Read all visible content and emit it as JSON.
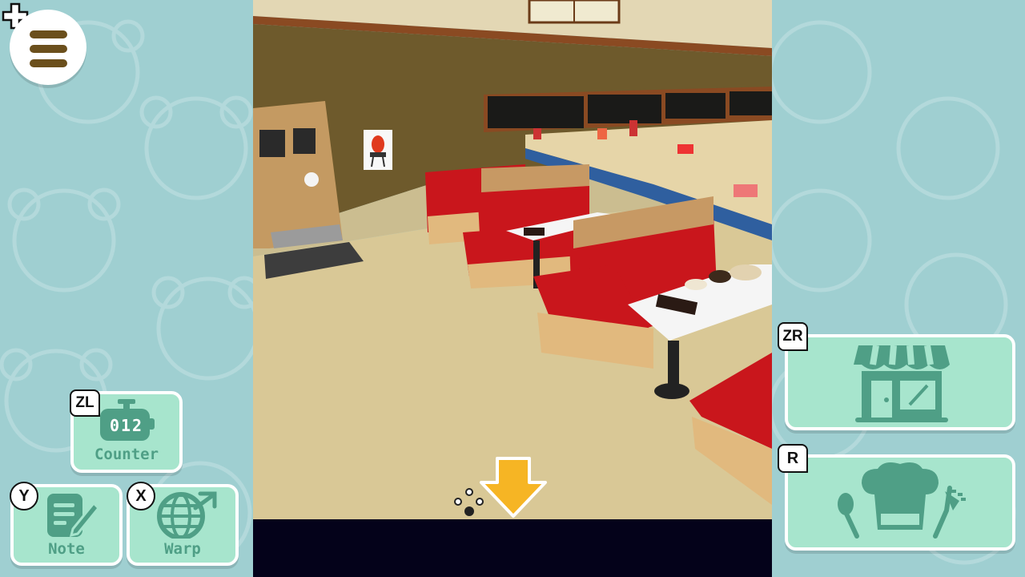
{
  "hud": {
    "menu_button": "menu",
    "plus_icon": "plus-icon"
  },
  "left_buttons": {
    "counter": {
      "key": "ZL",
      "label": "Counter",
      "value": "012"
    },
    "note": {
      "key": "Y",
      "label": "Note"
    },
    "warp": {
      "key": "X",
      "label": "Warp"
    }
  },
  "right_buttons": {
    "shop": {
      "key": "ZR",
      "icon": "shop-icon"
    },
    "menu_cook": {
      "key": "R",
      "icon": "chef-hat-utensils-icon"
    }
  },
  "scene": {
    "poster_icon": "grill-icon",
    "direction_arrow": "down-arrow-icon",
    "paw_icon": "paw-icon"
  },
  "colors": {
    "side_bg": "#9fcfd1",
    "button_fill": "#a7e5cd",
    "button_text": "#4f9f86",
    "menu_bars": "#6b4f1c",
    "bottom_bar": "#04021a",
    "arrow": "#f6b524"
  }
}
